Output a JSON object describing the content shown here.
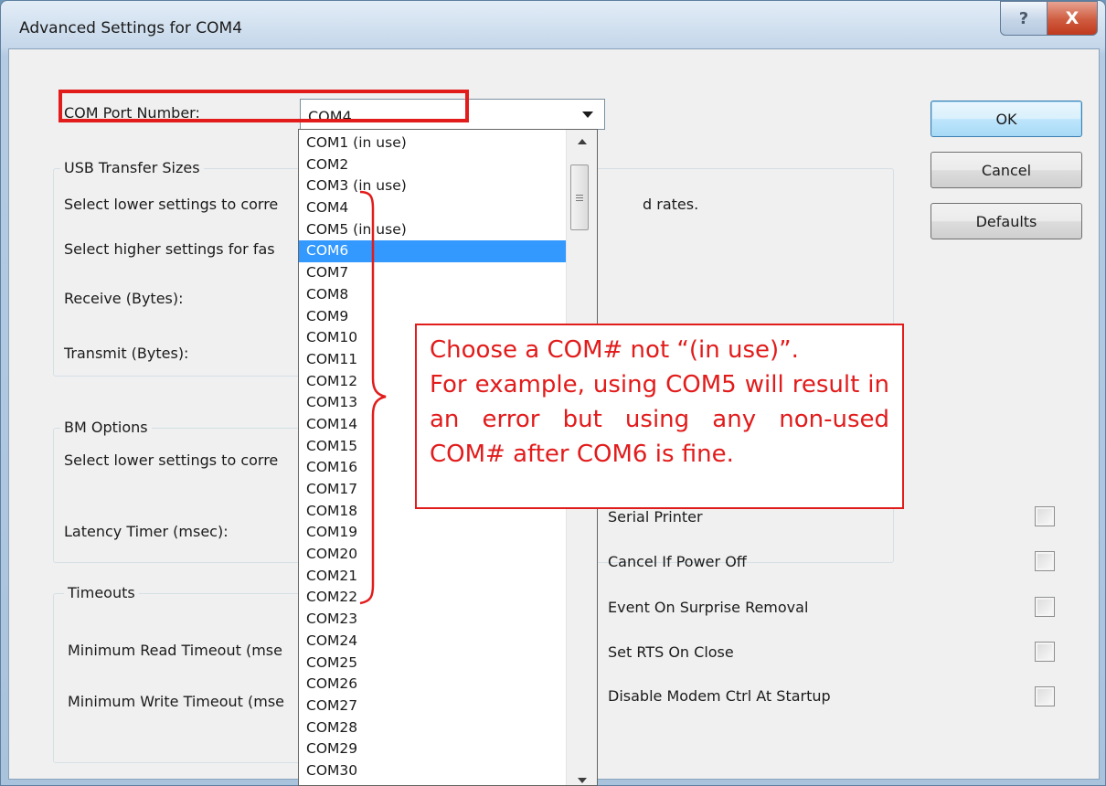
{
  "window": {
    "title": "Advanced Settings for COM4",
    "help_glyph": "?",
    "close_glyph": "X"
  },
  "com_port": {
    "label": "COM Port Number:",
    "value": "COM4",
    "options": [
      "COM1 (in use)",
      "COM2",
      "COM3 (in use)",
      "COM4",
      "COM5 (in use)",
      "COM6",
      "COM7",
      "COM8",
      "COM9",
      "COM10",
      "COM11",
      "COM12",
      "COM13",
      "COM14",
      "COM15",
      "COM16",
      "COM17",
      "COM18",
      "COM19",
      "COM20",
      "COM21",
      "COM22",
      "COM23",
      "COM24",
      "COM25",
      "COM26",
      "COM27",
      "COM28",
      "COM29",
      "COM30"
    ],
    "highlighted_option": "COM6"
  },
  "usb_transfer": {
    "title": "USB Transfer Sizes",
    "line1": "Select lower settings to corre",
    "line1_tail": "d rates.",
    "line2": "Select higher settings for fas",
    "receive_label": "Receive (Bytes):",
    "transmit_label": "Transmit (Bytes):"
  },
  "bm_options": {
    "title": "BM Options",
    "line1": "Select lower settings to corre",
    "latency_label": "Latency Timer (msec):"
  },
  "timeouts": {
    "title": "Timeouts",
    "min_read_label": "Minimum Read Timeout (mse",
    "min_write_label": "Minimum Write Timeout (mse"
  },
  "misc_options": [
    {
      "label": "Serial Printer",
      "checked": false
    },
    {
      "label": "Cancel If Power Off",
      "checked": false
    },
    {
      "label": "Event On Surprise Removal",
      "checked": false
    },
    {
      "label": "Set RTS On Close",
      "checked": false
    },
    {
      "label": "Disable Modem Ctrl At Startup",
      "checked": false
    }
  ],
  "buttons": {
    "ok": "OK",
    "cancel": "Cancel",
    "defaults": "Defaults"
  },
  "annotation": {
    "line1": "Choose a COM# not “(in use)”.",
    "line2": "For example, using COM5 will result in an error but using any non-used COM# after COM6 is fine.",
    "color": "#e21b1b"
  }
}
